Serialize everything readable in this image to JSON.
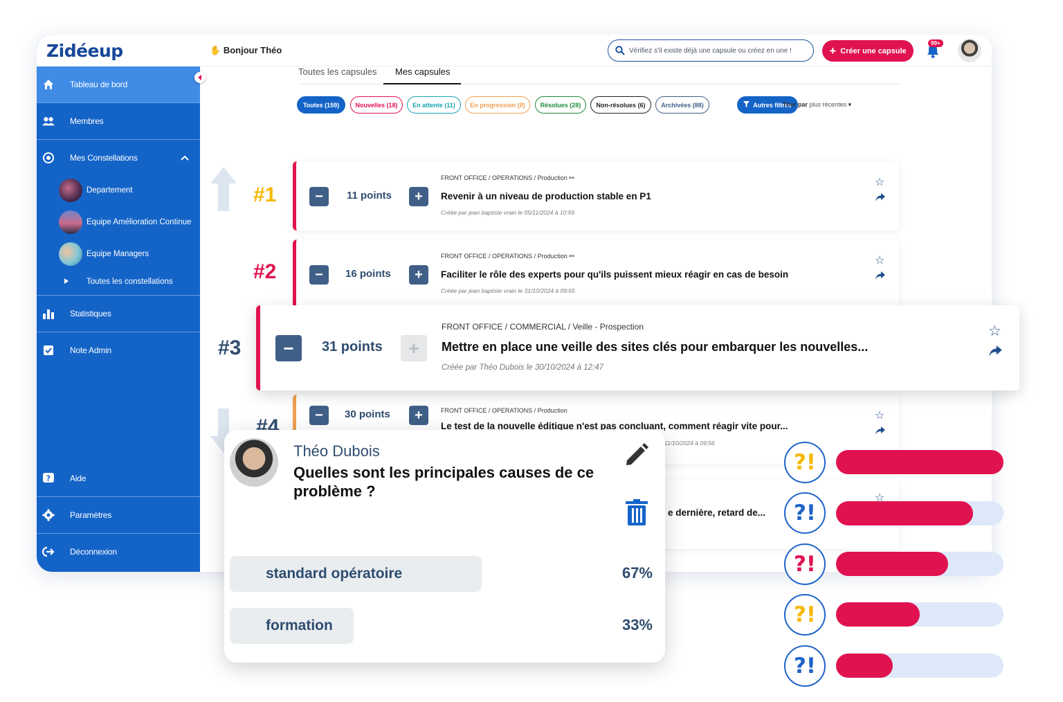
{
  "brand": {
    "logo": "Zidéeup",
    "accent": "#e0124f",
    "primary": "#1464c8"
  },
  "sidebar": {
    "items": [
      {
        "label": "Tableau de bord",
        "icon": "home-icon"
      },
      {
        "label": "Membres",
        "icon": "users-icon"
      },
      {
        "label": "Mes Constellations",
        "icon": "constellation-icon"
      },
      {
        "label": "Statistiques",
        "icon": "bar-chart-icon"
      },
      {
        "label": "Note Admin",
        "icon": "checkbox-icon"
      },
      {
        "label": "Aide",
        "icon": "help-icon"
      },
      {
        "label": "Paramètres",
        "icon": "gear-icon"
      },
      {
        "label": "Déconnexion",
        "icon": "logout-icon"
      }
    ],
    "constellations": [
      "Departement",
      "Equipe Amélioration Continue",
      "Equipe Managers"
    ],
    "all_constellations": "Toutes les constellations"
  },
  "header": {
    "greeting": "Bonjour Théo",
    "search_placeholder": "Vérifiez s'il existe déjà une capsule ou créez en une !",
    "create_label": "Créer une capsule",
    "notif_count": "99+"
  },
  "tabs": [
    "Toutes les capsules",
    "Mes capsules"
  ],
  "filters": [
    {
      "label": "Toutes (159)",
      "color": "#1464c8"
    },
    {
      "label": "Nouvelles (18)",
      "color": "#e0124f"
    },
    {
      "label": "En attente (11)",
      "color": "#1aa3b3"
    },
    {
      "label": "En progression (8)",
      "color": "#f0a050"
    },
    {
      "label": "Résolues (28)",
      "color": "#1f8a3a"
    },
    {
      "label": "Non-résolues (6)",
      "color": "#222222"
    },
    {
      "label": "Archivées (88)",
      "color": "#3f5f87"
    }
  ],
  "other_filters": "Autres filtres",
  "sort": {
    "label": "Trier par",
    "value": "plus récentes"
  },
  "ranks": [
    "#1",
    "#2",
    "#3",
    "#4"
  ],
  "capsules": [
    {
      "points": "11 points",
      "crumb": "FRONT OFFICE / OPERATIONS / Production",
      "title": "Revenir à un niveau de production stable en P1",
      "meta": "Créée par jean baptiste vrain le 05/11/2024 à 10:59"
    },
    {
      "points": "16 points",
      "crumb": "FRONT OFFICE / OPERATIONS / Production",
      "title": "Faciliter le rôle des experts pour qu'ils puissent mieux réagir en cas de besoin",
      "meta": "Créée par jean baptiste vrain le 31/10/2024 à 09:55"
    },
    {
      "points": "31 points",
      "crumb": "FRONT OFFICE / COMMERCIAL / Veille - Prospection",
      "title": "Mettre en place une veille des sites clés pour embarquer les nouvelles...",
      "meta": "Créée par Théo Dubois le 30/10/2024 à 12:47"
    },
    {
      "points": "30 points",
      "crumb": "FRONT OFFICE / OPERATIONS / Production",
      "title": "Le test de la nouvelle éditique n'est pas concluant, comment réagir vite pour...",
      "meta": "11/10/2024 à 09:56"
    },
    {
      "title_tail": "e dernière, retard de..."
    }
  ],
  "popup": {
    "name": "Théo Dubois",
    "question": "Quelles sont les principales causes de ce problème ?",
    "options": [
      {
        "label": "standard opératoire",
        "pct": "67%",
        "share": 0.67
      },
      {
        "label": "formation",
        "pct": "33%",
        "share": 0.33
      }
    ]
  },
  "progress_bars": [
    {
      "symbol": "?!",
      "color": "#f5b800",
      "value": 1.0
    },
    {
      "symbol": "?!",
      "color": "#1e63c9",
      "value": 0.82
    },
    {
      "symbol": "?!",
      "color": "#e0124f",
      "value": 0.67
    },
    {
      "symbol": "?!",
      "color": "#f5b800",
      "value": 0.5
    },
    {
      "symbol": "?!",
      "color": "#1e63c9",
      "value": 0.34
    }
  ]
}
